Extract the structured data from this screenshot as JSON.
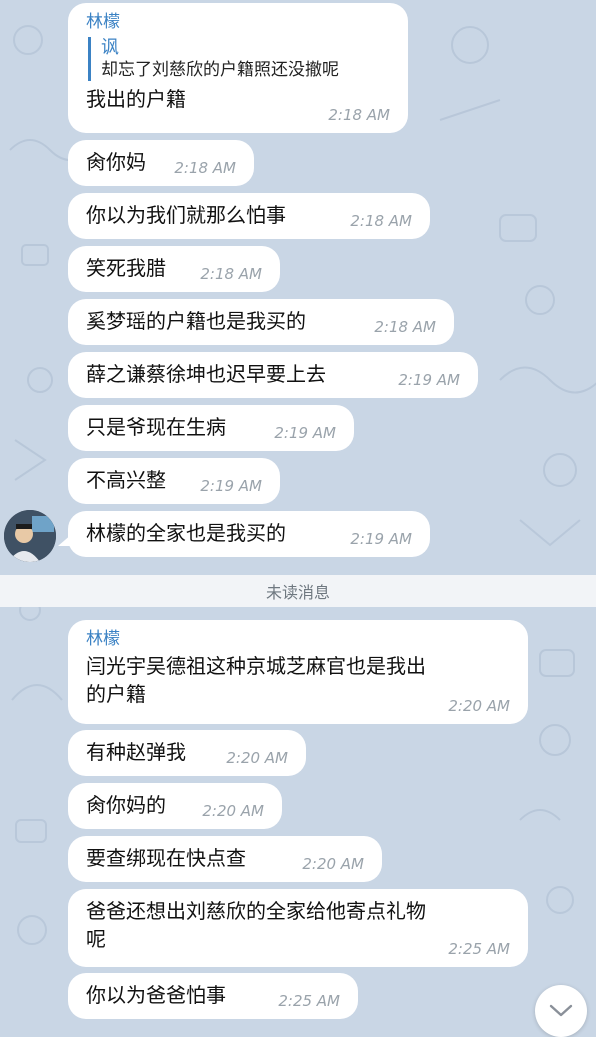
{
  "messages_before": [
    {
      "sender": "林檬",
      "reply_name": "讽",
      "reply_text": "却忘了刘慈欣的户籍照还没撤呢",
      "text": "我出的户籍",
      "time": "2:18 AM"
    },
    {
      "text": "肏你妈",
      "time": "2:18 AM"
    },
    {
      "text": "你以为我们就那么怕事",
      "time": "2:18 AM"
    },
    {
      "text": "笑死我腊",
      "time": "2:18 AM"
    },
    {
      "text": "奚梦瑶的户籍也是我买的",
      "time": "2:18 AM"
    },
    {
      "text": "薛之谦蔡徐坤也迟早要上去",
      "time": "2:19 AM"
    },
    {
      "text": "只是爷现在生病",
      "time": "2:19 AM"
    },
    {
      "text": "不高兴整",
      "time": "2:19 AM"
    },
    {
      "text": "林檬的全家也是我买的",
      "time": "2:19 AM"
    }
  ],
  "unread_label": "未读消息",
  "messages_after": [
    {
      "sender": "林檬",
      "text": "闫光宇吴德祖这种京城芝麻官也是我出\n的户籍",
      "time": "2:20 AM"
    },
    {
      "text": "有种赵弹我",
      "time": "2:20 AM"
    },
    {
      "text": "肏你妈的",
      "time": "2:20 AM"
    },
    {
      "text": "要查绑现在快点查",
      "time": "2:20 AM"
    },
    {
      "text": "爸爸还想出刘慈欣的全家给他寄点礼物\n呢",
      "time": "2:25 AM"
    },
    {
      "text": "你以为爸爸怕事",
      "time": "2:25 AM"
    }
  ],
  "colors": {
    "background": "#c9d6e5",
    "bubble": "#ffffff",
    "accent": "#3b82c4",
    "time": "#9aa3ab"
  },
  "icons": {
    "scroll_down": "chevron-down-icon",
    "avatar": "user-avatar"
  }
}
